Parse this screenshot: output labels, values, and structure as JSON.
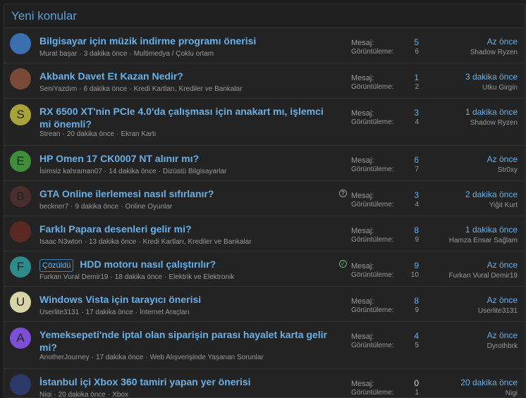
{
  "header": {
    "title": "Yeni konular"
  },
  "labels": {
    "replies": "Mesaj:",
    "views": "Görüntüleme:"
  },
  "threads": [
    {
      "title": "Bilgisayar için müzik indirme programı önerisi",
      "author": "Murat başar",
      "time": "3 dakika önce",
      "forum": "Multimedya / Çoklu ortam",
      "replies": "5",
      "views": "6",
      "last_time": "Az önce",
      "last_user": "Shadow Ryzen",
      "avatar": {
        "letter": "",
        "color": "#3a6fb0"
      }
    },
    {
      "title": "Akbank Davet Et Kazan Nedir?",
      "author": "SeniYazdım",
      "time": "6 dakika önce",
      "forum": "Kredi Kartları, Krediler ve Bankalar",
      "replies": "1",
      "views": "2",
      "last_time": "3 dakika önce",
      "last_user": "Utku Girgin",
      "avatar": {
        "letter": "",
        "color": "#7a4a38"
      }
    },
    {
      "title": "RX 6500 XT'nin PCIe 4.0'da çalışması için anakart mı, işlemci mi önemli?",
      "author": "Strean",
      "time": "20 dakika önce",
      "forum": "Ekran Kartı",
      "replies": "3",
      "views": "4",
      "last_time": "1 dakika önce",
      "last_user": "Shadow Ryzen",
      "avatar": {
        "letter": "S",
        "color": "#a8a23a"
      }
    },
    {
      "title": "HP Omen 17 CK0007 NT alınır mı?",
      "author": "İsimsiz kahraman07",
      "time": "14 dakika önce",
      "forum": "Dizüstü Bilgisayarlar",
      "replies": "6",
      "views": "7",
      "last_time": "Az önce",
      "last_user": "Str0xy",
      "avatar": {
        "letter": "E",
        "color": "#3f8f3a"
      }
    },
    {
      "title": "GTA Online ilerlemesi nasıl sıfırlanır?",
      "author": "beckner7",
      "time": "9 dakika önce",
      "forum": "Online Oyunlar",
      "replies": "3",
      "views": "4",
      "last_time": "2 dakika önce",
      "last_user": "Yiğit Kurt",
      "avatar": {
        "letter": "B",
        "color": "#4a2e2e"
      },
      "status": "question"
    },
    {
      "title": "Farklı Papara desenleri gelir mi?",
      "author": "Isaac N3wton",
      "time": "13 dakika önce",
      "forum": "Kredi Kartları, Krediler ve Bankalar",
      "replies": "8",
      "views": "9",
      "last_time": "1 dakika önce",
      "last_user": "Hamza Ensar Sağlam",
      "avatar": {
        "letter": "",
        "color": "#5a2a22"
      }
    },
    {
      "title": "HDD motoru nasıl çalıştırılır?",
      "prefix": "Çözüldü",
      "author": "Furkan Vural Demir19",
      "time": "18 dakika önce",
      "forum": "Elektrik ve Elektronik",
      "replies": "9",
      "views": "10",
      "last_time": "Az önce",
      "last_user": "Furkan Vural Demir19",
      "avatar": {
        "letter": "F",
        "color": "#2f8a8a"
      },
      "status": "solved"
    },
    {
      "title": "Windows Vista için tarayıcı önerisi",
      "author": "Userlite3131",
      "time": "17 dakika önce",
      "forum": "İnternet Araçları",
      "replies": "8",
      "views": "9",
      "last_time": "Az önce",
      "last_user": "Userlite3131",
      "avatar": {
        "letter": "U",
        "color": "#d8d4a8"
      }
    },
    {
      "title": "Yemeksepeti'nde iptal olan siparişin parası hayalet karta gelir mi?",
      "author": "AnotherJourney",
      "time": "17 dakika önce",
      "forum": "Web Alışverişinde Yaşanan Sorunlar",
      "replies": "4",
      "views": "5",
      "last_time": "Az önce",
      "last_user": "Dyrothbrk",
      "avatar": {
        "letter": "A",
        "color": "#7d4fd6"
      }
    },
    {
      "title": "İstanbul içi Xbox 360 tamiri yapan yer önerisi",
      "author": "Nigi",
      "time": "20 dakika önce",
      "forum": "Xbox",
      "replies": "0",
      "views": "1",
      "last_time": "20 dakika önce",
      "last_user": "Nigi",
      "avatar": {
        "letter": "",
        "color": "#2c3a6a"
      }
    }
  ]
}
